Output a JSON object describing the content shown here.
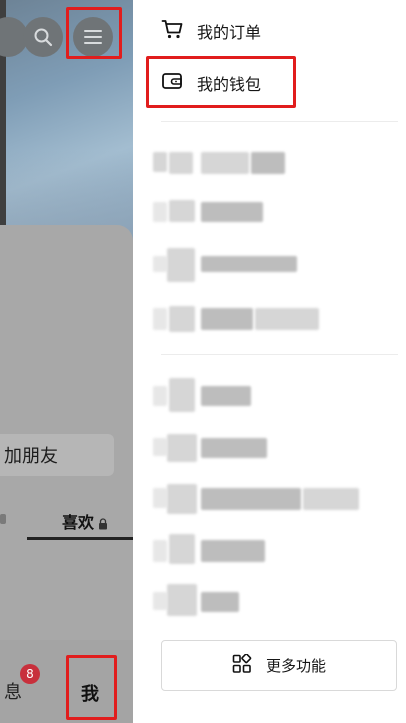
{
  "left_panel": {
    "add_friend_label": "加朋友",
    "tab_like_label": "喜欢",
    "tab_message_label": "息",
    "message_badge_count": "8",
    "tab_me_label": "我"
  },
  "drawer": {
    "menu_items": [
      {
        "label": "我的订单",
        "icon": "cart-icon"
      },
      {
        "label": "我的钱包",
        "icon": "wallet-icon"
      }
    ],
    "more_button_label": "更多功能",
    "more_button_icon": "grid-icon"
  },
  "colors": {
    "highlight": "#e11d1d",
    "badge": "#c8303c"
  }
}
